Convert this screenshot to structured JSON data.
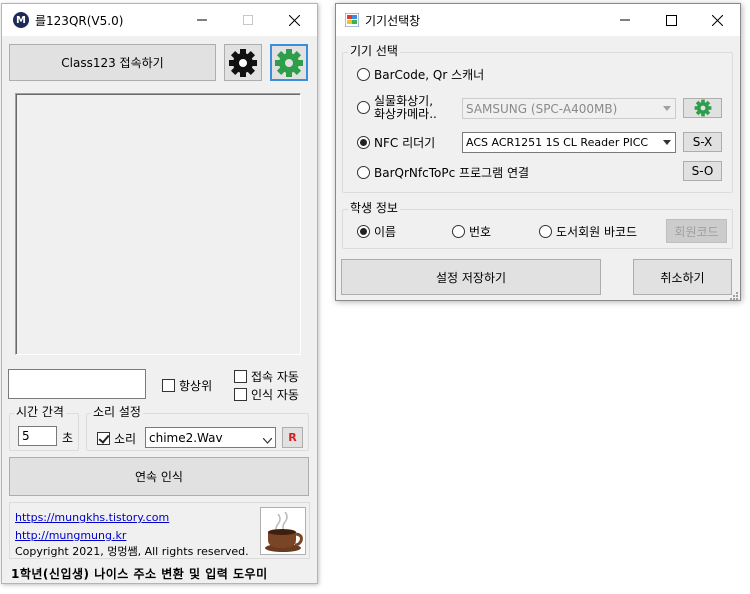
{
  "main_window": {
    "title": "를123QR(V5.0)",
    "connect_button": "Class123 접속하기",
    "icons": [
      "gear-black-icon",
      "gear-green-icon"
    ],
    "always_on_top": "항상위",
    "auto_connect": "접속 자동",
    "auto_recognize": "인식 자동",
    "time_group": {
      "title": "시간 간격",
      "value": "5",
      "unit": "초"
    },
    "sound_group": {
      "title": "소리 설정",
      "checkbox": "소리",
      "checked": true,
      "selected": "chime2.Wav",
      "r_button": "R"
    },
    "continuous_button": "연속 인식",
    "links": [
      "https://mungkhs.tistory.com",
      "http://mungmung.kr"
    ],
    "copyright": "Copyright 2021, 멍멍쌤, All rights reserved.",
    "footer": "1학년(신입생) 나이스 주소 변환 및 입력 도우미"
  },
  "device_window": {
    "title": "기기선택창",
    "device_group": {
      "title": "기기 선택",
      "options": [
        {
          "label": "BarCode, Qr 스캐너",
          "checked": false
        },
        {
          "label_line1": "실물화상기,",
          "label_line2": "화상카메라..",
          "checked": false,
          "combo": "SAMSUNG (SPC-A400MB)"
        },
        {
          "label": "NFC 리더기",
          "checked": true,
          "combo": "ACS ACR1251 1S CL Reader PICC",
          "button": "S-X"
        },
        {
          "label": "BarQrNfcToPc 프로그램 연결",
          "checked": false,
          "button": "S-O"
        }
      ]
    },
    "student_group": {
      "title": "학생 정보",
      "options": [
        {
          "label": "이름",
          "checked": true
        },
        {
          "label": "번호",
          "checked": false
        },
        {
          "label": "도서회원 바코드",
          "checked": false
        }
      ],
      "member_code_button": "회원코드"
    },
    "save_button": "설정 저장하기",
    "cancel_button": "취소하기"
  },
  "colors": {
    "accent_green": "#2f9e4a",
    "link": "#0000cc",
    "r_red": "#d42020",
    "highlight_border": "#3b8fd9"
  }
}
